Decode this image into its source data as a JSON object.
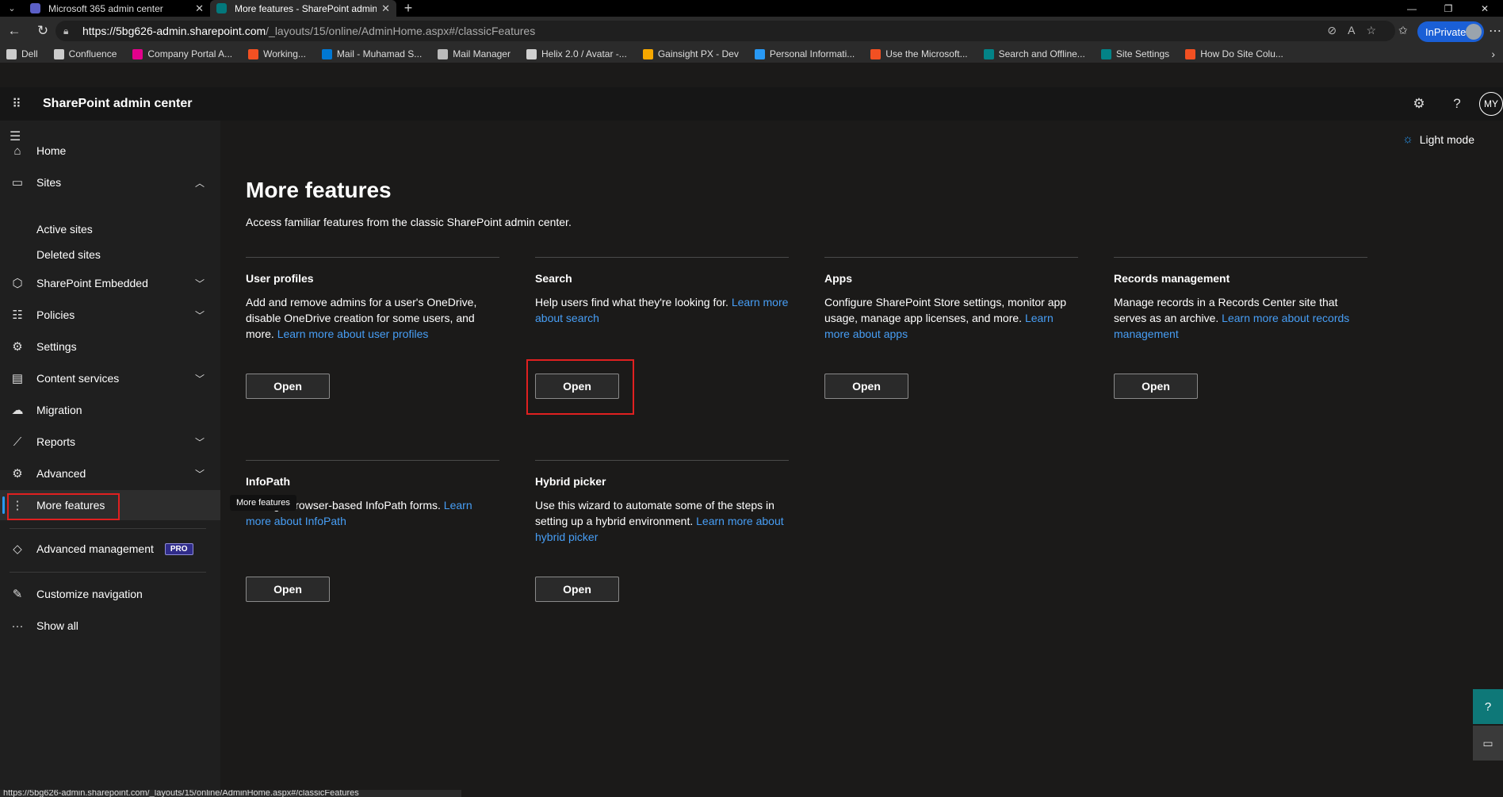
{
  "browser": {
    "tabs": [
      {
        "title": "Microsoft 365 admin center",
        "active": false,
        "favicon_color": "#5b5fc7"
      },
      {
        "title": "More features - SharePoint admin",
        "active": true,
        "favicon_color": "#03787c"
      }
    ],
    "url_host": "https://5bg626-admin.sharepoint.com",
    "url_path": "/_layouts/15/online/AdminHome.aspx#/classicFeatures",
    "inprivate_label": "InPrivate",
    "bookmarks": [
      {
        "label": "Dell",
        "color": "#cccccc"
      },
      {
        "label": "Confluence",
        "color": "#cccccc"
      },
      {
        "label": "Company Portal A...",
        "color": "#e3008c"
      },
      {
        "label": "Working...",
        "color": "#f25022"
      },
      {
        "label": "Mail - Muhamad S...",
        "color": "#0078d4"
      },
      {
        "label": "Mail Manager",
        "color": "#bbbbbb"
      },
      {
        "label": "Helix 2.0 / Avatar -...",
        "color": "#d0d0d0"
      },
      {
        "label": "Gainsight PX - Dev",
        "color": "#f7a800"
      },
      {
        "label": "Personal Informati...",
        "color": "#2899f5"
      },
      {
        "label": "Use the Microsoft...",
        "color": "#f25022"
      },
      {
        "label": "Search and Offline...",
        "color": "#038387"
      },
      {
        "label": "Site Settings",
        "color": "#038387"
      },
      {
        "label": "How Do Site Colu...",
        "color": "#f25022"
      }
    ],
    "status_url": "https://5bg626-admin.sharepoint.com/_layouts/15/online/AdminHome.aspx#/classicFeatures"
  },
  "header": {
    "app_title": "SharePoint admin center",
    "avatar_initials": "MY"
  },
  "sidebar": {
    "items": [
      {
        "label": "Home",
        "icon": "home-icon"
      },
      {
        "label": "Sites",
        "icon": "sites-icon"
      },
      {
        "label": "SharePoint Embedded",
        "icon": "cube-icon"
      },
      {
        "label": "Policies",
        "icon": "policies-icon"
      },
      {
        "label": "Settings",
        "icon": "gear-icon"
      },
      {
        "label": "Content services",
        "icon": "content-icon"
      },
      {
        "label": "Migration",
        "icon": "cloud-icon"
      },
      {
        "label": "Reports",
        "icon": "chart-icon"
      },
      {
        "label": "Advanced",
        "icon": "advanced-icon"
      },
      {
        "label": "More features",
        "icon": "more-vertical-icon"
      },
      {
        "label": "Advanced management",
        "icon": "diamond-icon"
      },
      {
        "label": "Customize navigation",
        "icon": "pencil-icon"
      },
      {
        "label": "Show all",
        "icon": "ellipsis-icon"
      }
    ],
    "sites_sub": [
      "Active sites",
      "Deleted sites"
    ],
    "pro_badge": "PRO",
    "tooltip": "More features"
  },
  "main": {
    "light_mode_label": "Light mode",
    "title": "More features",
    "description": "Access familiar features from the classic SharePoint admin center.",
    "cards": [
      {
        "title": "User profiles",
        "text": "Add and remove admins for a user's OneDrive, disable OneDrive creation for some users, and more. ",
        "link": "Learn more about user profiles",
        "button": "Open"
      },
      {
        "title": "Search",
        "text": "Help users find what they're looking for. ",
        "link": "Learn more about search",
        "button": "Open"
      },
      {
        "title": "Apps",
        "text": "Configure SharePoint Store settings, monitor app usage, manage app licenses, and more. ",
        "link": "Learn more about apps",
        "button": "Open"
      },
      {
        "title": "Records management",
        "text": "Manage records in a Records Center site that serves as an archive. ",
        "link": "Learn more about records management",
        "button": "Open"
      },
      {
        "title": "InfoPath",
        "text": "Manage browser-based InfoPath forms. ",
        "link": "Learn more about InfoPath",
        "button": "Open"
      },
      {
        "title": "Hybrid picker",
        "text": "Use this wizard to automate some of the steps in setting up a hybrid environment. ",
        "link": "Learn more about hybrid picker",
        "button": "Open"
      }
    ]
  }
}
